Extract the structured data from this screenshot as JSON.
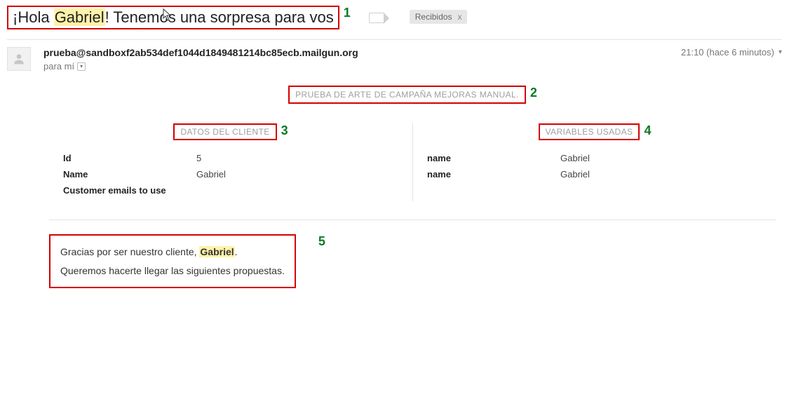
{
  "subject": {
    "prefix": "¡Hola ",
    "highlight": "Gabriel",
    "suffix": "! Tenemos una sorpresa para vos"
  },
  "label": {
    "name": "Recibidos",
    "close": "x"
  },
  "from": "prueba@sandboxf2ab534def1044d1849481214bc85ecb.mailgun.org",
  "to_line": "para mí",
  "time": "21:10 (hace 6 minutos)",
  "campaign_title": "PRUEBA DE ARTE DE CAMPAÑA MEJORAS MANUAL.",
  "section_client": "DATOS DEL CLIENTE",
  "section_vars": "VARIABLES USADAS",
  "client": [
    {
      "k": "Id",
      "v": "5"
    },
    {
      "k": "Name",
      "v": "Gabriel"
    },
    {
      "k": "Customer emails to use",
      "v": ""
    }
  ],
  "vars": [
    {
      "k": "name",
      "v": "Gabriel"
    },
    {
      "k": "name",
      "v": "Gabriel"
    }
  ],
  "message": {
    "line1_a": "Gracias por ser nuestro cliente, ",
    "line1_b_bold": "Gabriel",
    "line1_c": ".",
    "line2": "Queremos hacerte llegar las siguientes propuestas."
  },
  "annot": {
    "a1": "1",
    "a2": "2",
    "a3": "3",
    "a4": "4",
    "a5": "5"
  }
}
